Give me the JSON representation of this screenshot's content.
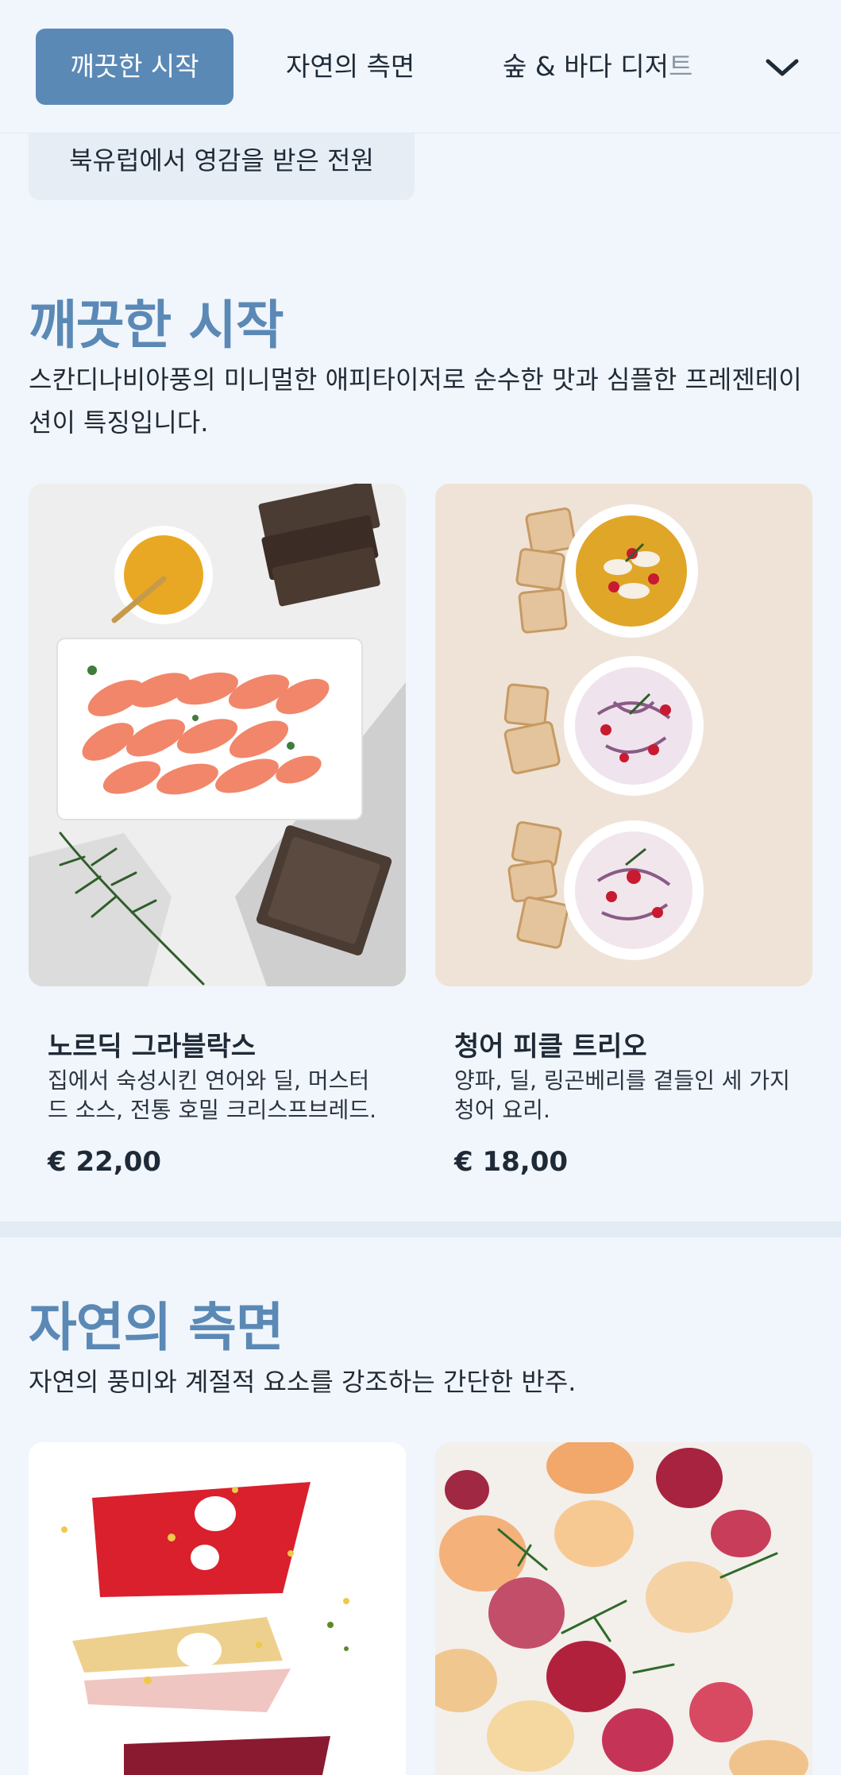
{
  "nav": {
    "tabs": [
      {
        "label": "깨끗한 시작"
      },
      {
        "label": "자연의 측면"
      },
      {
        "label": "숲 & 바다 디저",
        "label_fade": "트"
      }
    ],
    "more_icon": "chevron-down-icon"
  },
  "subnav": {
    "chip_label": "북유럽에서 영감을 받은 전원"
  },
  "sections": [
    {
      "title": "깨끗한 시작",
      "description": "스칸디나비아풍의 미니멀한 애피타이저로 순수한 맛과 심플한 프레젠테이션이 특징입니다.",
      "items": [
        {
          "name": "노르딕 그라블락스",
          "description": "집에서 숙성시킨 연어와 딜, 머스터드 소스, 전통 호밀 크리스프브레드.",
          "price": "€ 22,00"
        },
        {
          "name": "청어 피클 트리오",
          "description": "양파, 딜, 링곤베리를 곁들인 세 가지 청어 요리.",
          "price": "€ 18,00"
        }
      ]
    },
    {
      "title": "자연의 측면",
      "description": "자연의 풍미와 계절적 요소를 강조하는 간단한 반주."
    }
  ],
  "colors": {
    "accent": "#5b89b6",
    "background": "#f1f6fc",
    "text": "#1f2a37"
  }
}
